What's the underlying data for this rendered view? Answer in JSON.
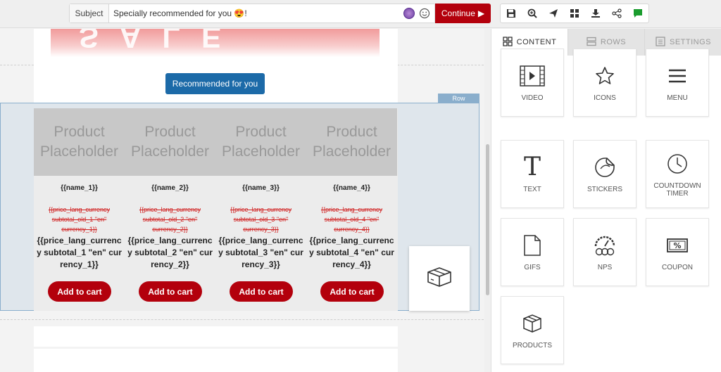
{
  "topbar": {
    "subject_label": "Subject",
    "subject_value": "Specially recommended for you 😍!",
    "continue_label": "Continue",
    "tools": [
      "save-icon",
      "zoom-icon",
      "send-icon",
      "grid-icon",
      "download-icon",
      "share-icon",
      "comment-icon"
    ]
  },
  "canvas": {
    "hero_letters": "SALE",
    "recommended_button": "Recommended for you",
    "row_tag": "Row",
    "products": [
      {
        "placeholder": "Product Placeholder",
        "name": "{{name_1}}",
        "old_price": "{{price_lang_currency subtotal_old_1 \"en\" currency_1}}",
        "price": "{{price_lang_currency subtotal_1 \"en\" currency_1}}",
        "cart": "Add to cart"
      },
      {
        "placeholder": "Product Placeholder",
        "name": "{{name_2}}",
        "old_price": "{{price_lang_currency subtotal_old_2 \"en\" currency_2}}",
        "price": "{{price_lang_currency subtotal_2 \"en\" currency_2}}",
        "cart": "Add to cart"
      },
      {
        "placeholder": "Product Placeholder",
        "name": "{{name_3}}",
        "old_price": "{{price_lang_currency subtotal_old_3 \"en\" currency_3}}",
        "price": "{{price_lang_currency subtotal_3 \"en\" currency_3}}",
        "cart": "Add to cart"
      },
      {
        "placeholder": "Product Placeholder",
        "name": "{{name_4}}",
        "old_price": "{{price_lang_currency subtotal_old_4 \"en\" currency_4}}",
        "price": "{{price_lang_currency subtotal_4 \"en\" currency_4}}",
        "cart": "Add to cart"
      }
    ]
  },
  "panel": {
    "tabs": [
      "CONTENT",
      "ROWS",
      "SETTINGS"
    ],
    "active_tab": "CONTENT",
    "tiles": [
      "VIDEO",
      "ICONS",
      "MENU",
      "TEXT",
      "STICKERS",
      "COUNTDOWN TIMER",
      "GIFS",
      "NPS",
      "COUPON",
      "PRODUCTS"
    ]
  },
  "colors": {
    "accent_red": "#b3000c",
    "button_blue": "#1c6aa8",
    "selection_blue": "#8aaecc"
  }
}
